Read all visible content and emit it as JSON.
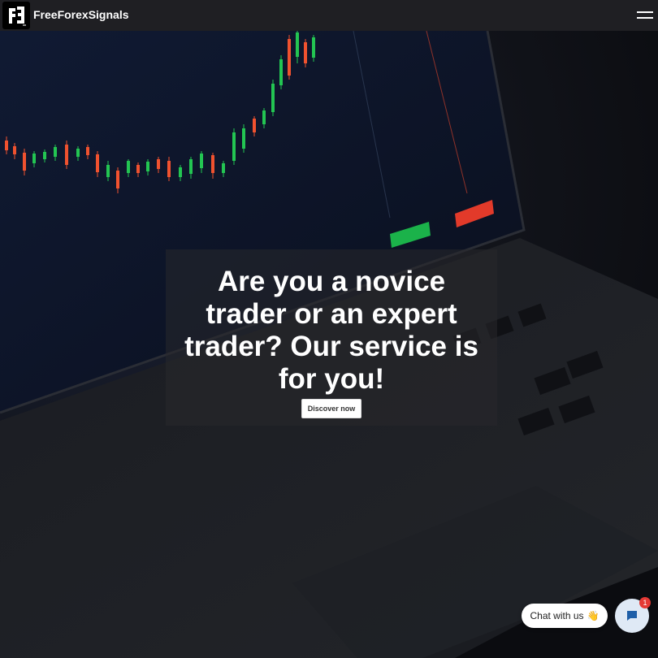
{
  "header": {
    "brand": "FreeForexSignals",
    "logo_icon": "ff-logo-icon",
    "menu_icon": "hamburger-menu-icon"
  },
  "hero": {
    "headline": "Are you a novice trader or an expert trader? Our service is for you!",
    "cta_label": "Discover now",
    "background": "laptop with candlestick trading chart"
  },
  "chat": {
    "label": "Chat with us",
    "emoji": "👋",
    "badge_count": "1",
    "icon": "chat-bubble-icon"
  },
  "colors": {
    "topbar": "#1f1f23",
    "candle_up": "#23c552",
    "candle_down": "#f0522f",
    "badge": "#e53935"
  }
}
